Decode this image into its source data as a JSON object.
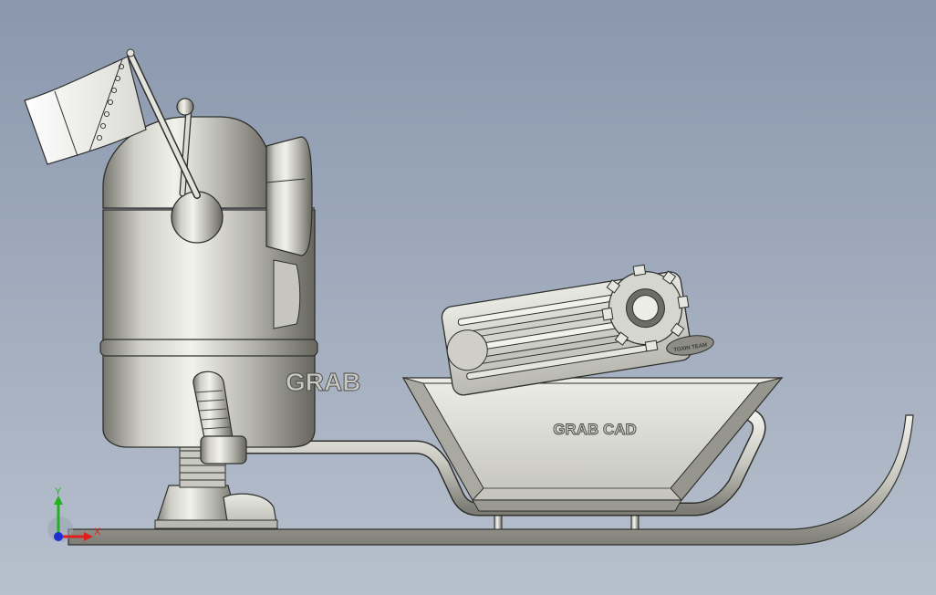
{
  "colors": {
    "background_top": "#8a97ad",
    "background_bottom": "#b7c0cd",
    "metal_light": "#e6e6e0",
    "metal_mid": "#b8b8b2",
    "metal_dark": "#6c6c66",
    "outline": "#2f2f2c",
    "axis_x": "#e0201c",
    "axis_y": "#1fb31f",
    "axis_z": "#1a2fd6"
  },
  "model": {
    "body_engraving": "GRAB",
    "sled_engraving": "GRAB CAD",
    "hub_stamp": "TOXIN TEAM"
  },
  "triad": {
    "x_label": "X",
    "y_label": "Y"
  }
}
